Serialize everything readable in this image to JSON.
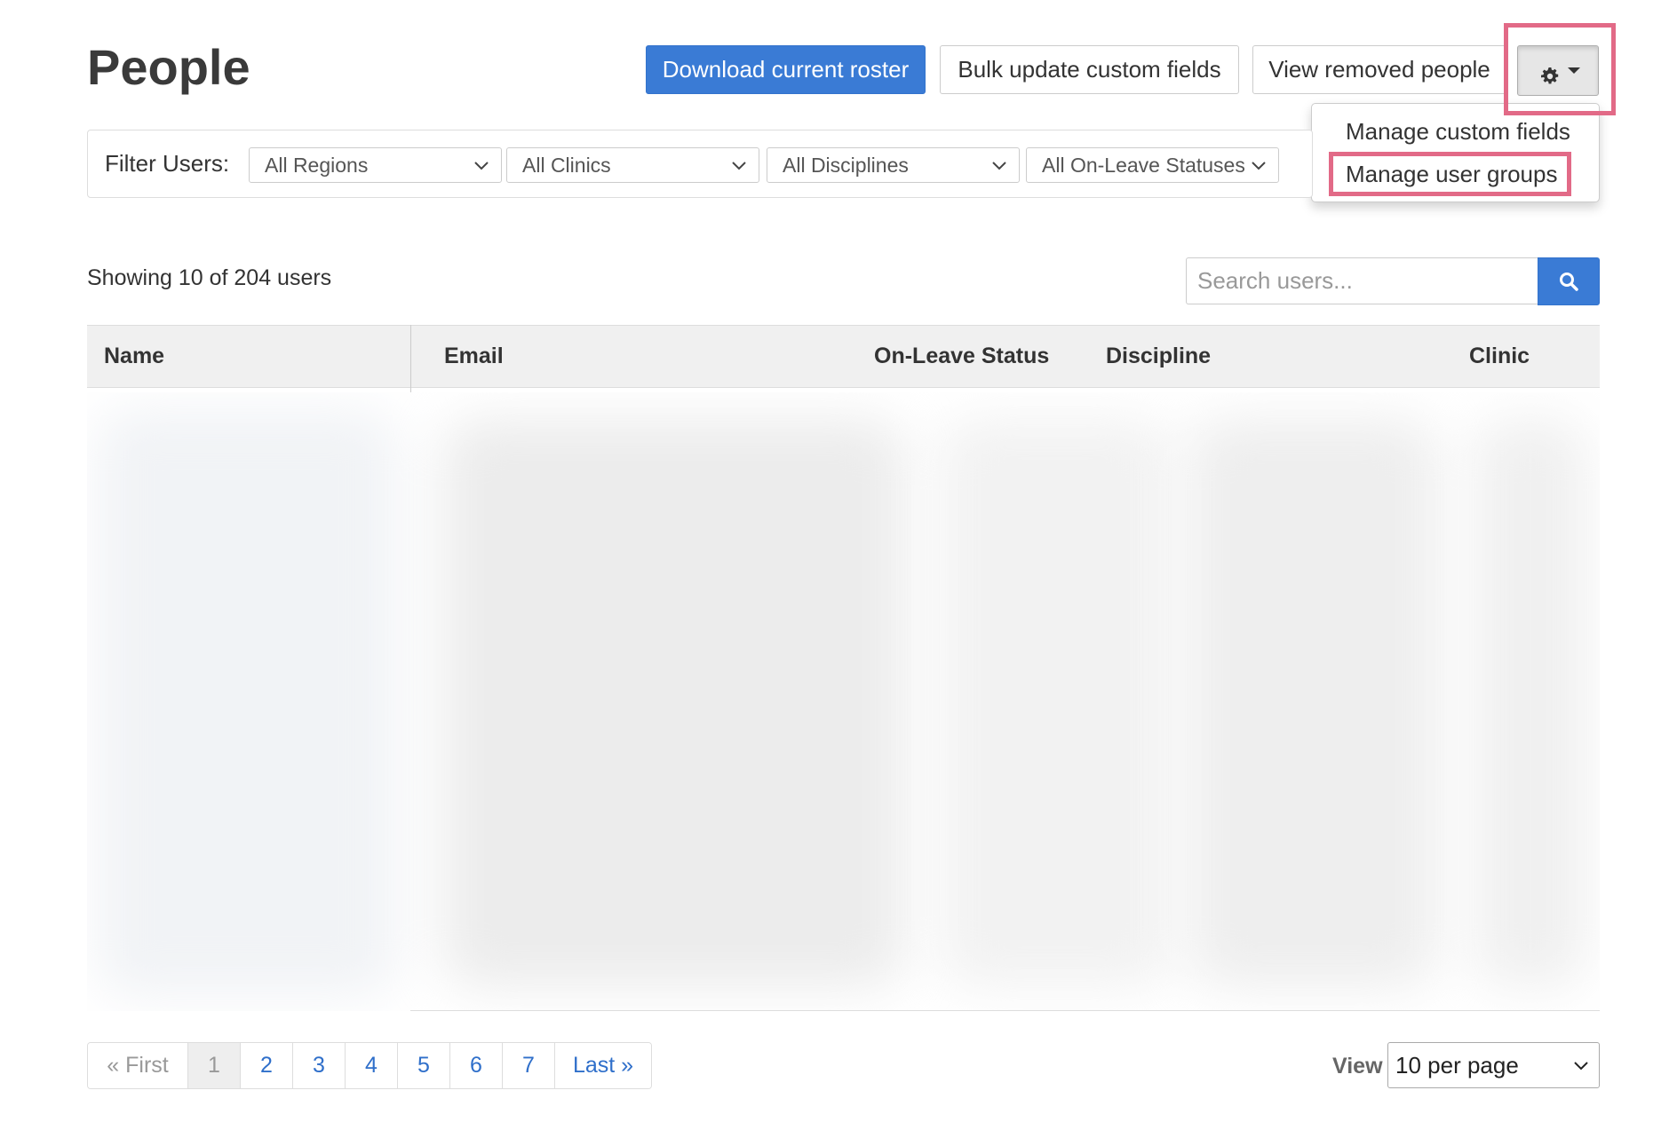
{
  "page": {
    "title": "People"
  },
  "toolbar": {
    "download_label": "Download current roster",
    "bulk_label": "Bulk update custom fields",
    "removed_label": "View removed people"
  },
  "settings_menu": {
    "items": [
      {
        "label": "Manage custom fields"
      },
      {
        "label": "Manage user groups"
      }
    ],
    "highlighted_item": "Manage user groups"
  },
  "filters": {
    "label": "Filter Users:",
    "region": "All Regions",
    "clinic": "All Clinics",
    "discipline": "All Disciplines",
    "leave": "All On-Leave Statuses"
  },
  "summary": {
    "showing": "Showing 10 of 204 users"
  },
  "search": {
    "placeholder": "Search users..."
  },
  "table": {
    "columns": [
      "Name",
      "Email",
      "On-Leave Status",
      "Discipline",
      "Clinic"
    ]
  },
  "pagination": {
    "first": "« First",
    "pages": [
      "1",
      "2",
      "3",
      "4",
      "5",
      "6",
      "7"
    ],
    "active_page": "1",
    "last": "Last »"
  },
  "per_page": {
    "label": "View",
    "value": "10 per page"
  },
  "colors": {
    "primary": "#3a7bd5",
    "highlight": "#e26a87",
    "link": "#2f6fca"
  }
}
